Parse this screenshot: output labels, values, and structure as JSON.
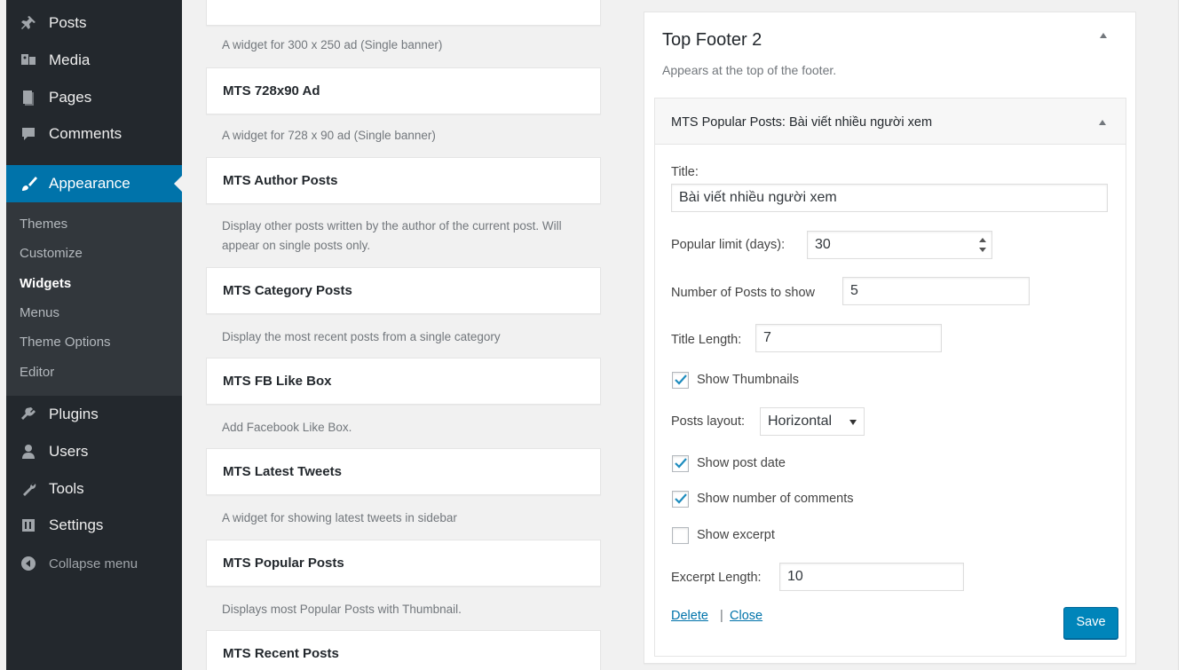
{
  "sidebar": {
    "menu": [
      {
        "label": "Posts",
        "icon": "pin-icon"
      },
      {
        "label": "Media",
        "icon": "media-icon"
      },
      {
        "label": "Pages",
        "icon": "pages-icon"
      },
      {
        "label": "Comments",
        "icon": "comment-icon"
      },
      {
        "label": "Appearance",
        "icon": "brush-icon"
      },
      {
        "label": "Plugins",
        "icon": "plug-icon"
      },
      {
        "label": "Users",
        "icon": "user-icon"
      },
      {
        "label": "Tools",
        "icon": "wrench-icon"
      },
      {
        "label": "Settings",
        "icon": "settings-icon"
      }
    ],
    "submenu": [
      "Themes",
      "Customize",
      "Widgets",
      "Menus",
      "Theme Options",
      "Editor"
    ],
    "collapse": "Collapse menu",
    "accent": "#0073aa"
  },
  "available": {
    "top_desc": "A widget for 300 x 250 ad (Single banner)",
    "widgets": [
      {
        "title": "MTS 728x90 Ad",
        "desc": "A widget for 728 x 90 ad (Single banner)"
      },
      {
        "title": "MTS Author Posts",
        "desc": "Display other posts written by the author of the current post. Will appear on single posts only."
      },
      {
        "title": "MTS Category Posts",
        "desc": "Display the most recent posts from a single category"
      },
      {
        "title": "MTS FB Like Box",
        "desc": "Add Facebook Like Box."
      },
      {
        "title": "MTS Latest Tweets",
        "desc": "A widget for showing latest tweets in sidebar"
      },
      {
        "title": "MTS Popular Posts",
        "desc": "Displays most Popular Posts with Thumbnail."
      },
      {
        "title": "MTS Recent Posts",
        "desc": ""
      }
    ]
  },
  "area": {
    "title": "Top Footer 2",
    "desc": "Appears at the top of the footer.",
    "widget": {
      "name": "MTS Popular Posts",
      "suffix": ": Bài viết nhiều người xem",
      "title_label": "Title:",
      "title_value": "Bài viết nhiều người xem",
      "limit_label": "Popular limit (days):",
      "limit_value": "30",
      "num_label": "Number of Posts to show",
      "num_value": "5",
      "len_label": "Title Length:",
      "len_value": "7",
      "thumbs_label": "Show Thumbnails",
      "thumbs_checked": true,
      "layout_label": "Posts layout:",
      "layout_value": "Horizontal",
      "date_label": "Show post date",
      "date_checked": true,
      "comments_label": "Show number of comments",
      "comments_checked": true,
      "excerpt_label": "Show excerpt",
      "excerpt_checked": false,
      "excerpt_len_label": "Excerpt Length:",
      "excerpt_len_value": "10",
      "delete": "Delete",
      "sep": "|",
      "close": "Close",
      "save": "Save"
    }
  }
}
